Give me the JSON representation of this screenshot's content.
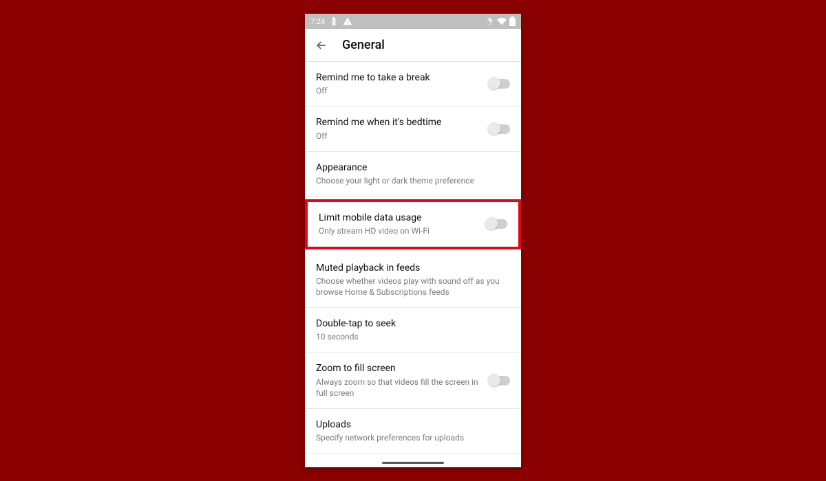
{
  "statusbar": {
    "time": "7:24"
  },
  "header": {
    "title": "General"
  },
  "settings": {
    "break": {
      "title": "Remind me to take a break",
      "subtitle": "Off"
    },
    "bedtime": {
      "title": "Remind me when it's bedtime",
      "subtitle": "Off"
    },
    "appearance": {
      "title": "Appearance",
      "subtitle": "Choose your light or dark theme preference"
    },
    "limitdata": {
      "title": "Limit mobile data usage",
      "subtitle": "Only stream HD video on Wi-Fi"
    },
    "muted": {
      "title": "Muted playback in feeds",
      "subtitle": "Choose whether videos play with sound off as you browse Home & Subscriptions feeds"
    },
    "doubletap": {
      "title": "Double-tap to seek",
      "subtitle": "10 seconds"
    },
    "zoom": {
      "title": "Zoom to fill screen",
      "subtitle": "Always zoom so that videos fill the screen in full screen"
    },
    "uploads": {
      "title": "Uploads",
      "subtitle": "Specify network preferences for uploads"
    }
  }
}
